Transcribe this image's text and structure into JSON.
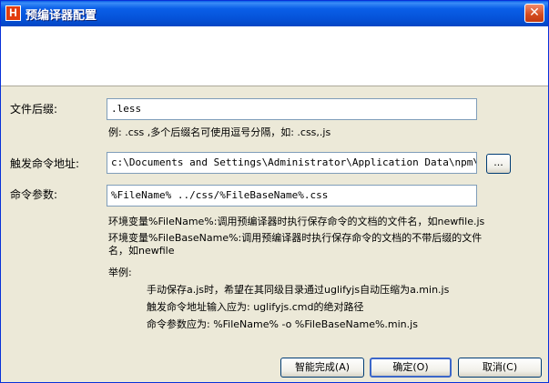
{
  "window": {
    "title": "预编译器配置",
    "icon_letter": "H",
    "close_glyph": "✕"
  },
  "form": {
    "ext_label": "文件后缀:",
    "ext_value": ".less",
    "ext_hint": "例: .css ,多个后缀名可使用逗号分隔，如: .css,.js",
    "cmd_label": "触发命令地址:",
    "cmd_value": "c:\\Documents and Settings\\Administrator\\Application Data\\npm\\lessc.",
    "browse_label": "...",
    "args_label": "命令参数:",
    "args_value": "%FileName% ../css/%FileBaseName%.css"
  },
  "help": {
    "var1": "环境变量%FileName%:调用预编译器时执行保存命令的文档的文件名，如newfile.js",
    "var2_line1": "环境变量%FileBaseName%:调用预编译器时执行保存命令的文档的不带后缀的文件",
    "var2_line2": "名，如newfile",
    "example_title": "举例:",
    "example_1": "手动保存a.js时，希望在其同级目录通过uglifyjs自动压缩为a.min.js",
    "example_2": "触发命令地址输入应为: uglifyjs.cmd的绝对路径",
    "example_3": "命令参数应为: %FileName% -o %FileBaseName%.min.js"
  },
  "buttons": {
    "smart": "智能完成(A)",
    "ok": "确定(O)",
    "cancel": "取消(C)"
  }
}
